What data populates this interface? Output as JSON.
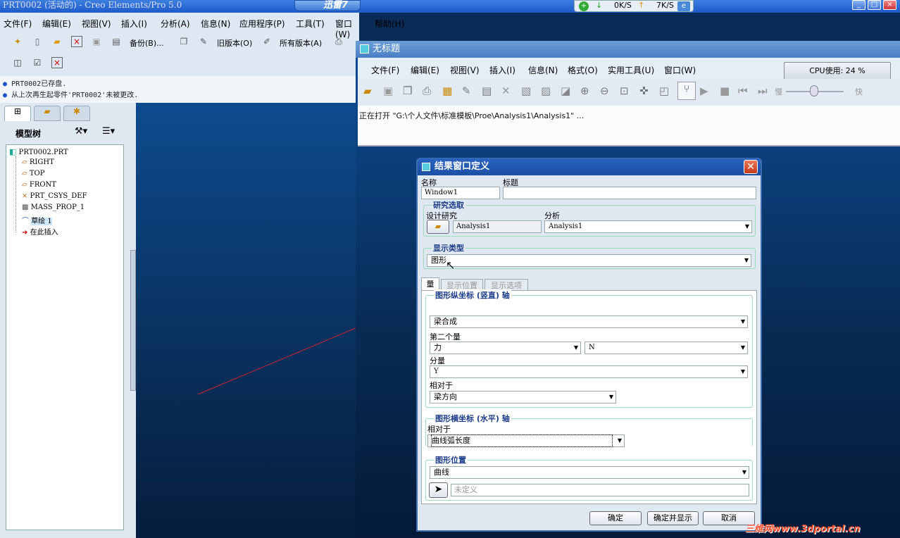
{
  "app": {
    "title": "PRT0002 (活动的) - Creo Elements/Pro 5.0"
  },
  "xunlei": {
    "label": "迅雷7"
  },
  "speed": {
    "down": "0K/S",
    "up": "7K/S"
  },
  "main_menu": [
    "文件(F)",
    "编辑(E)",
    "视图(V)",
    "插入(I)",
    "分析(A)",
    "信息(N)",
    "应用程序(P)",
    "工具(T)",
    "窗口(W)",
    "帮助(H)"
  ],
  "toolbar": {
    "backup": "备份(B)...",
    "old_version": "旧版本(O)",
    "all_versions": "所有版本(A)"
  },
  "messages": [
    "PRT0002已存盘.",
    "从上次再生起零件'PRT0002'未被更改."
  ],
  "panel": {
    "title": "模型树"
  },
  "tree": [
    {
      "label": "PRT0002.PRT",
      "icon": "part-icon"
    },
    {
      "label": "RIGHT",
      "icon": "datum-plane-icon"
    },
    {
      "label": "TOP",
      "icon": "datum-plane-icon"
    },
    {
      "label": "FRONT",
      "icon": "datum-plane-icon"
    },
    {
      "label": "PRT_CSYS_DEF",
      "icon": "csys-icon"
    },
    {
      "label": "MASS_PROP_1",
      "icon": "analysis-icon"
    },
    {
      "label": "草绘 1",
      "icon": "sketch-icon"
    },
    {
      "label": "在此插入",
      "icon": "insert-arrow-icon"
    }
  ],
  "win2": {
    "title": "无标题",
    "menu": [
      "文件(F)",
      "编辑(E)",
      "视图(V)",
      "插入(I)",
      "信息(N)",
      "格式(O)",
      "实用工具(U)",
      "窗口(W)"
    ],
    "cpu": "CPU使用: 24 %",
    "message": "正在打开 \"G:\\个人文件\\标准模板\\Proe\\Analysis1\\Analysis1\" ...",
    "slow": "慢",
    "fast": "快"
  },
  "dialog": {
    "title": "结果窗口定义",
    "name_label": "名称",
    "name_value": "Window1",
    "title_label": "标题",
    "title_value": "",
    "study_group": "研究选取",
    "design_label": "设计研究",
    "design_value": "Analysis1",
    "analysis_label": "分析",
    "analysis_value": "Analysis1",
    "display_group": "显示类型",
    "display_value": "图形",
    "tabs": [
      "量",
      "显示位置",
      "显示选项"
    ],
    "y_group": "图形纵坐标 (竖直) 轴",
    "y_quantity": "梁合成",
    "second_label": "第二个量",
    "second_value": "力",
    "second_unit": "N",
    "component_label": "分量",
    "component_value": "Y",
    "relative_label": "相对于",
    "relative_value": "梁方向",
    "x_group": "图形横坐标 (水平) 轴",
    "x_relative_label": "相对于",
    "x_relative_value": "曲线弧长度",
    "pos_group": "图形位置",
    "pos_value": "曲线",
    "pos_placeholder": "未定义",
    "ok": "确定",
    "ok_show": "确定并显示",
    "cancel": "取消"
  },
  "watermark": "三维网www.3dportal.cn"
}
